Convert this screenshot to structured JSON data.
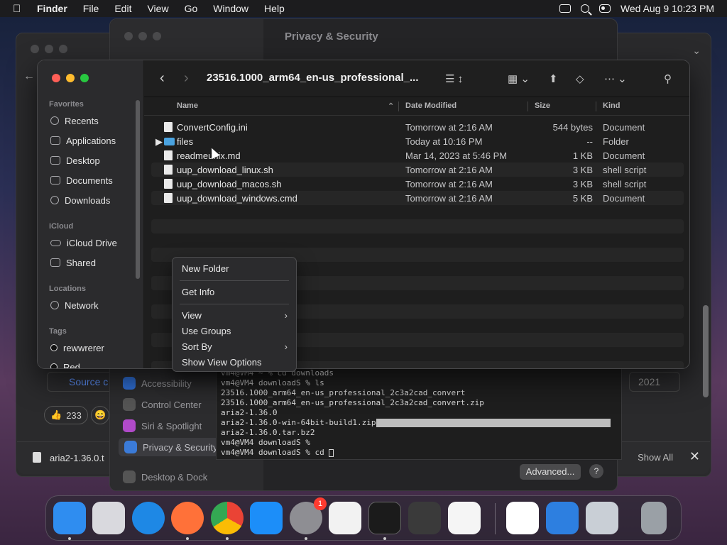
{
  "menubar": {
    "app_name": "Finder",
    "menus": [
      "File",
      "Edit",
      "View",
      "Go",
      "Window",
      "Help"
    ],
    "clock": "Wed Aug 9  10:23 PM",
    "icons": [
      "screen-mirroring-icon",
      "search-icon",
      "control-center-icon"
    ]
  },
  "settings": {
    "title": "Privacy & Security",
    "items": [
      "Accessibility",
      "Control Center",
      "Siri & Spotlight",
      "Privacy & Security",
      "Desktop & Dock"
    ],
    "advanced_label": "Advanced...",
    "help_label": "?"
  },
  "browser": {
    "source_label": "Source c",
    "year_label": "2021",
    "reaction_count": "233",
    "download_file": "aria2-1.36.0.t",
    "show_all": "Show All",
    "close": "✕"
  },
  "terminal": {
    "lines": [
      "vm4@VM4 ~ % cd downloads",
      "vm4@VM4 downloadS % ls",
      "23516.1000_arm64_en-us_professional_2c3a2cad_convert",
      "23516.1000_arm64_en-us_professional_2c3a2cad_convert.zip",
      "aria2-1.36.0",
      "aria2-1.36.0-win-64bit-build1.zip",
      "aria2-1.36.0.tar.bz2",
      "vm4@VM4 downloadS %",
      "vm4@VM4 downloadS % cd "
    ]
  },
  "finder": {
    "path_title": "23516.1000_arm64_en-us_professional_...",
    "sidebar": {
      "favorites_label": "Favorites",
      "favorites": [
        {
          "label": "Recents",
          "icon": "clock-icon"
        },
        {
          "label": "Applications",
          "icon": "applications-icon"
        },
        {
          "label": "Desktop",
          "icon": "desktop-icon"
        },
        {
          "label": "Documents",
          "icon": "document-icon"
        },
        {
          "label": "Downloads",
          "icon": "downloads-icon"
        }
      ],
      "icloud_label": "iCloud",
      "icloud": [
        {
          "label": "iCloud Drive",
          "icon": "cloud-icon"
        },
        {
          "label": "Shared",
          "icon": "shared-folder-icon"
        }
      ],
      "locations_label": "Locations",
      "locations": [
        {
          "label": "Network",
          "icon": "globe-icon"
        }
      ],
      "tags_label": "Tags",
      "tags": [
        {
          "label": "rewwrerer",
          "color": "#111111"
        },
        {
          "label": "Red",
          "color": "#111111"
        }
      ]
    },
    "columns": {
      "name": "Name",
      "date": "Date Modified",
      "size": "Size",
      "kind": "Kind"
    },
    "files": [
      {
        "name": "ConvertConfig.ini",
        "date": "Tomorrow at 2:16 AM",
        "size": "544 bytes",
        "kind": "Document",
        "type": "file"
      },
      {
        "name": "files",
        "date": "Today at 10:16 PM",
        "size": "--",
        "kind": "Folder",
        "type": "folder"
      },
      {
        "name": "readmeunix.md",
        "date": "Mar 14, 2023 at 5:46 PM",
        "size": "1 KB",
        "kind": "Document",
        "type": "file"
      },
      {
        "name": "uup_download_linux.sh",
        "date": "Tomorrow at 2:16 AM",
        "size": "3 KB",
        "kind": "shell script",
        "type": "file"
      },
      {
        "name": "uup_download_macos.sh",
        "date": "Tomorrow at 2:16 AM",
        "size": "3 KB",
        "kind": "shell script",
        "type": "file"
      },
      {
        "name": "uup_download_windows.cmd",
        "date": "Tomorrow at 2:16 AM",
        "size": "5 KB",
        "kind": "Document",
        "type": "file"
      }
    ]
  },
  "context_menu": {
    "items": [
      "New Folder",
      "Get Info",
      "View",
      "Use Groups",
      "Sort By",
      "Show View Options"
    ]
  },
  "dock": {
    "apps": [
      {
        "name": "finder-icon",
        "color": "#2f8df0"
      },
      {
        "name": "launchpad-icon",
        "color": "#d9d9de"
      },
      {
        "name": "safari-icon",
        "color": "#1e88e5"
      },
      {
        "name": "firefox-icon",
        "color": "#ff7139"
      },
      {
        "name": "chrome-icon",
        "color": "#e8e8e8"
      },
      {
        "name": "app-store-icon",
        "color": "#1c8ef9"
      },
      {
        "name": "system-settings-icon",
        "color": "#8e8e93",
        "badge": "1"
      },
      {
        "name": "textedit-icon",
        "color": "#f2f2f2"
      },
      {
        "name": "terminal-icon",
        "color": "#1b1b1b"
      },
      {
        "name": "garageband-icon",
        "color": "#3a3a3a"
      },
      {
        "name": "vscode-icon",
        "color": "#f5f5f5"
      },
      {
        "name": "visual-studio-icon",
        "color": "#ffffff"
      },
      {
        "name": "weather-icon",
        "color": "#2d7fe0"
      },
      {
        "name": "archive-utility-icon",
        "color": "#c9cfd6"
      },
      {
        "name": "trash-icon",
        "color": "#9aa0a6"
      }
    ]
  }
}
